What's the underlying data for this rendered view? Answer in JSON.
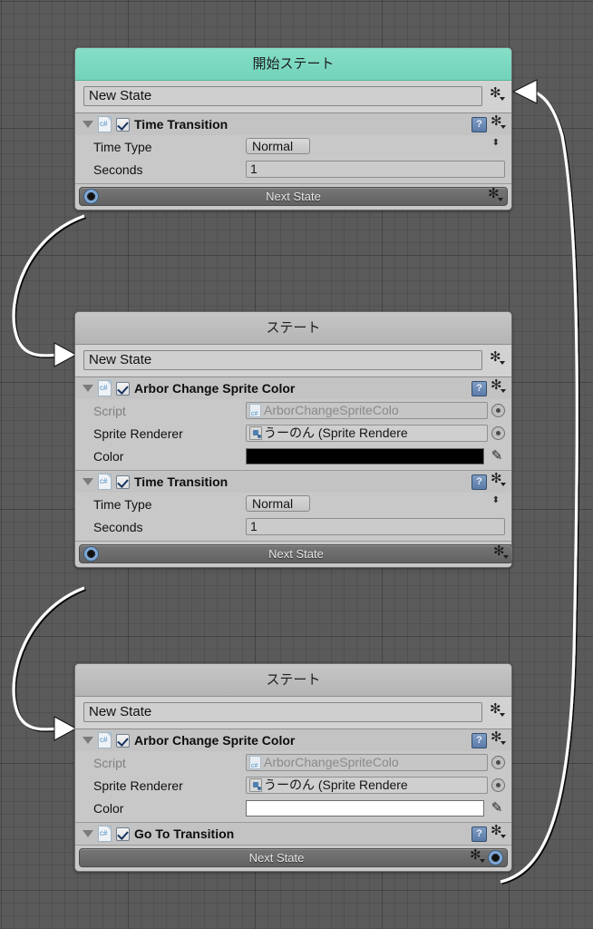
{
  "editor": {
    "background_color": "#5a5a5a",
    "grid_color": "#4e4e4e",
    "start_header_color": "#77d6bd",
    "node_header_color": "#bdbdbd",
    "connector_color": "#7ea8d6",
    "edge_color": "#ffffff"
  },
  "nodes": [
    {
      "id": "node-start",
      "header_title": "開始ステート",
      "is_start": true,
      "state_name": "New State",
      "name_placeholder": "New State",
      "behaviours": [
        {
          "title": "Time Transition",
          "enabled": true,
          "script_icon": "csharp-script-icon",
          "help_icon": "help-book-icon",
          "menu_icon": "gear-icon",
          "properties": [
            {
              "label": "Time Type",
              "type": "dropdown",
              "value": "Normal"
            },
            {
              "label": "Seconds",
              "type": "text",
              "value": "1"
            }
          ]
        }
      ],
      "next_state_label": "Next State",
      "connector_side": "left"
    },
    {
      "id": "node-second",
      "header_title": "ステート",
      "is_start": false,
      "state_name": "New State",
      "name_placeholder": "New State",
      "behaviours": [
        {
          "title": "Arbor Change Sprite Color",
          "enabled": true,
          "script_icon": "csharp-script-icon",
          "help_icon": "help-book-icon",
          "menu_icon": "gear-icon",
          "properties": [
            {
              "label": "Script",
              "type": "object",
              "value": "ArborChangeSpriteColo",
              "dim": true,
              "icon": "csharp-script-icon"
            },
            {
              "label": "Sprite Renderer",
              "type": "object",
              "value": "うーのん (Sprite Rendere",
              "dim": false,
              "icon": "sprite-renderer-icon"
            },
            {
              "label": "Color",
              "type": "color",
              "value": "#000000"
            }
          ]
        },
        {
          "title": "Time Transition",
          "enabled": true,
          "script_icon": "csharp-script-icon",
          "help_icon": "help-book-icon",
          "menu_icon": "gear-icon",
          "properties": [
            {
              "label": "Time Type",
              "type": "dropdown",
              "value": "Normal"
            },
            {
              "label": "Seconds",
              "type": "text",
              "value": "1"
            }
          ]
        }
      ],
      "next_state_label": "Next State",
      "connector_side": "left"
    },
    {
      "id": "node-third",
      "header_title": "ステート",
      "is_start": false,
      "state_name": "New State",
      "name_placeholder": "New State",
      "behaviours": [
        {
          "title": "Arbor Change Sprite Color",
          "enabled": true,
          "script_icon": "csharp-script-icon",
          "help_icon": "help-book-icon",
          "menu_icon": "gear-icon",
          "properties": [
            {
              "label": "Script",
              "type": "object",
              "value": "ArborChangeSpriteColo",
              "dim": true,
              "icon": "csharp-script-icon"
            },
            {
              "label": "Sprite Renderer",
              "type": "object",
              "value": "うーのん (Sprite Rendere",
              "dim": false,
              "icon": "sprite-renderer-icon"
            },
            {
              "label": "Color",
              "type": "color",
              "value": "#ffffff"
            }
          ]
        },
        {
          "title": "Go To Transition",
          "enabled": true,
          "script_icon": "csharp-script-icon",
          "help_icon": "help-book-icon",
          "menu_icon": "gear-icon",
          "properties": []
        }
      ],
      "next_state_label": "Next State",
      "connector_side": "right"
    }
  ],
  "glyphs": {
    "dropdown_arrows": "▴\n▾",
    "eyedropper": "✎",
    "foldout": "▼"
  }
}
